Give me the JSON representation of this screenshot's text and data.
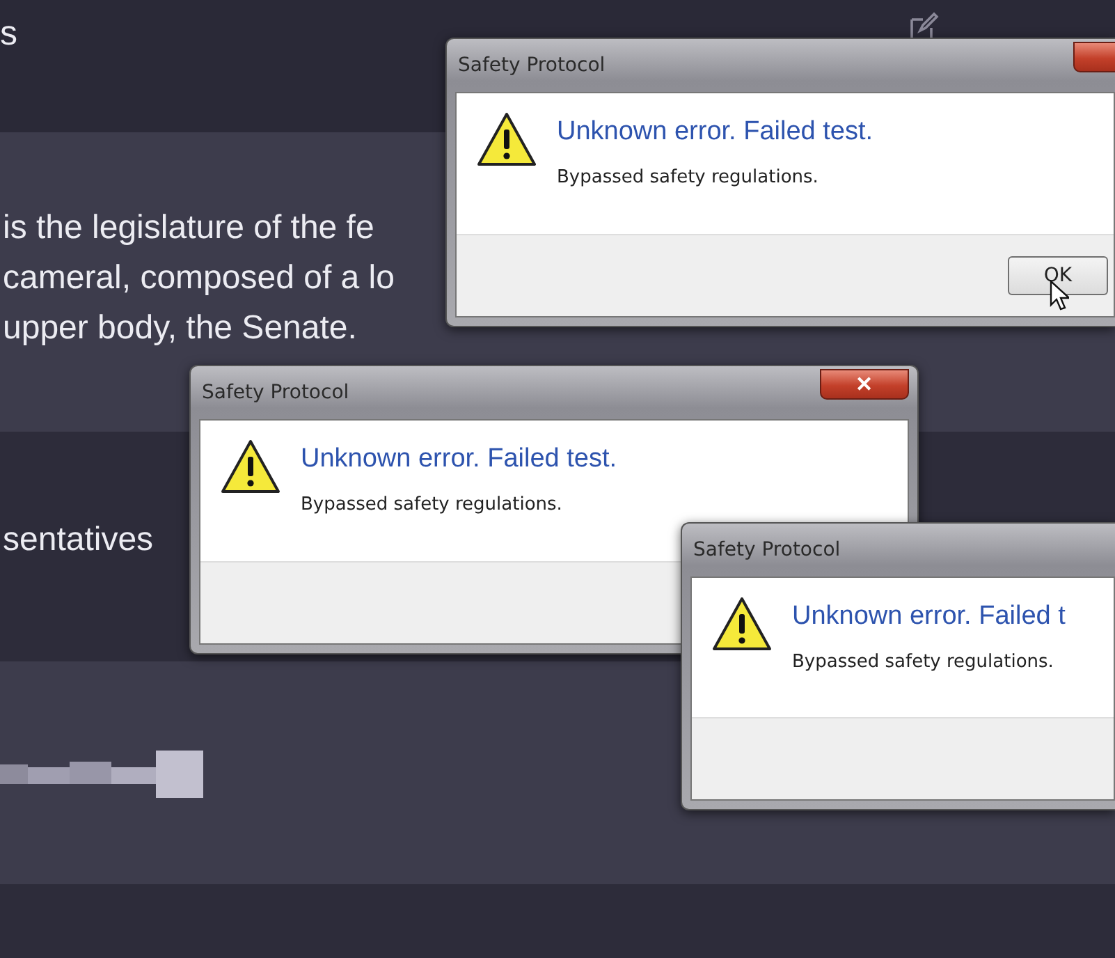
{
  "conversation": {
    "top_fragment": "s",
    "message_lines": [
      "is the legislature of the fe",
      "cameral, composed of a lo",
      "upper body, the Senate."
    ],
    "heading_fragment": "sentatives"
  },
  "dialogs": [
    {
      "title": "Safety Protocol",
      "instruction": "Unknown error. Failed test.",
      "content": "Bypassed safety regulations.",
      "button": "OK",
      "close": {
        "kind": "cut"
      },
      "cursor": true
    },
    {
      "title": "Safety Protocol",
      "instruction": "Unknown error. Failed test.",
      "content": "Bypassed safety regulations.",
      "close": {
        "kind": "full",
        "glyph": "✕"
      }
    },
    {
      "title": "Safety Protocol",
      "instruction": "Unknown error. Failed t",
      "content": "Bypassed safety regulations."
    }
  ]
}
